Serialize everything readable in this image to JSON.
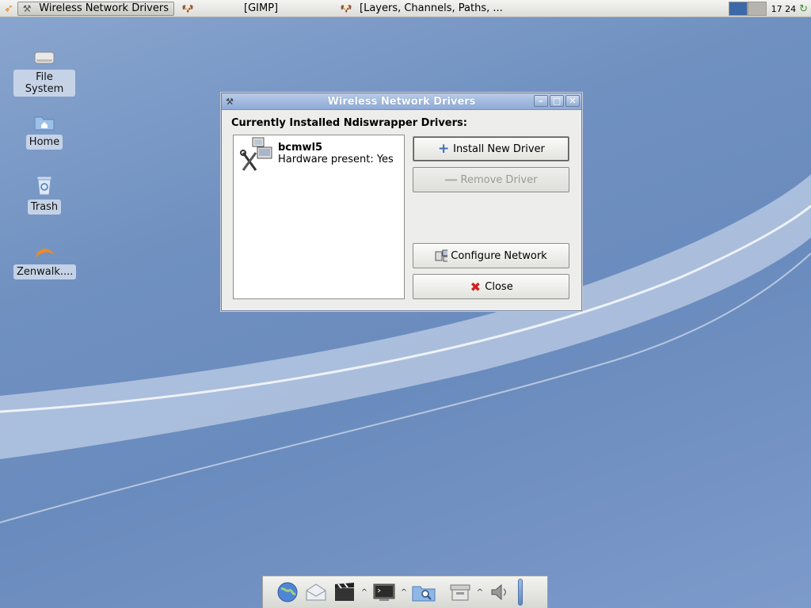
{
  "top_panel": {
    "tasks": [
      {
        "label": "Wireless Network Drivers",
        "icon": "wrench-icon",
        "active": true
      },
      {
        "label": "[GIMP]",
        "icon": "gimp-icon",
        "active": false
      },
      {
        "label": "[Layers, Channels, Paths, ...",
        "icon": "gimp-icon",
        "active": false
      }
    ],
    "clock": "17 24"
  },
  "desktop": {
    "icons": [
      {
        "label": "File System",
        "icon": "drive-icon"
      },
      {
        "label": "Home",
        "icon": "home-folder-icon"
      },
      {
        "label": "Trash",
        "icon": "trash-icon"
      },
      {
        "label": "Zenwalk....",
        "icon": "zenwalk-icon"
      }
    ]
  },
  "window": {
    "title": "Wireless Network Drivers",
    "heading": "Currently Installed Ndiswrapper Drivers:",
    "drivers": [
      {
        "name": "bcmwl5",
        "status": "Hardware present: Yes"
      }
    ],
    "buttons": {
      "install": "Install New Driver",
      "remove": "Remove Driver",
      "configure": "Configure Network",
      "close": "Close"
    }
  },
  "dock": {
    "items": [
      "browser-icon",
      "mail-icon",
      "media-icon",
      "terminal-icon",
      "search-folder-icon",
      "archive-icon",
      "volume-icon"
    ]
  }
}
